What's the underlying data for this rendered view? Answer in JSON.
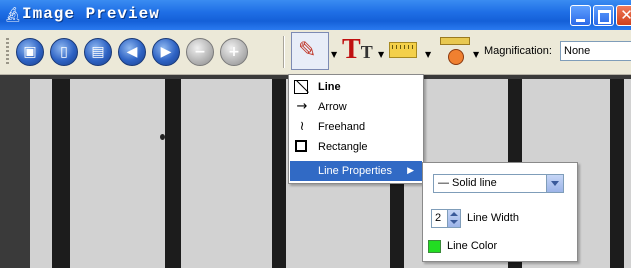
{
  "window": {
    "title": "Image Preview",
    "title_icon": "microscope-icon"
  },
  "toolbar": {
    "buttons": [
      {
        "name": "save-icon"
      },
      {
        "name": "document-icon"
      },
      {
        "name": "print-icon"
      },
      {
        "name": "previous-icon"
      },
      {
        "name": "next-icon"
      },
      {
        "name": "zoom-out-icon"
      },
      {
        "name": "zoom-in-icon"
      }
    ],
    "tools": [
      {
        "name": "draw-pencil-icon"
      },
      {
        "name": "text-icon"
      },
      {
        "name": "ruler-icon"
      },
      {
        "name": "measure-icon"
      }
    ],
    "magnification_label": "Magnification:",
    "magnification_value": "None"
  },
  "draw_menu": {
    "items": [
      {
        "label": "Line",
        "icon": "line-icon",
        "bold": true
      },
      {
        "label": "Arrow",
        "icon": "arrow-icon"
      },
      {
        "label": "Freehand",
        "icon": "freehand-icon"
      },
      {
        "label": "Rectangle",
        "icon": "rectangle-icon"
      },
      {
        "label": "Line Properties",
        "icon": "submenu-arrow-icon",
        "selected": true
      }
    ]
  },
  "line_properties": {
    "line_style": "— Solid line",
    "line_width_value": "2",
    "line_width_label": "Line Width",
    "line_color_label": "Line Color",
    "line_color": "#22dd22"
  },
  "colors": {
    "titlebar": "#1f6fe6",
    "menu_highlight": "#316ac5",
    "image_background": "#d2d2d2",
    "stripe": "#1c1c1c"
  }
}
